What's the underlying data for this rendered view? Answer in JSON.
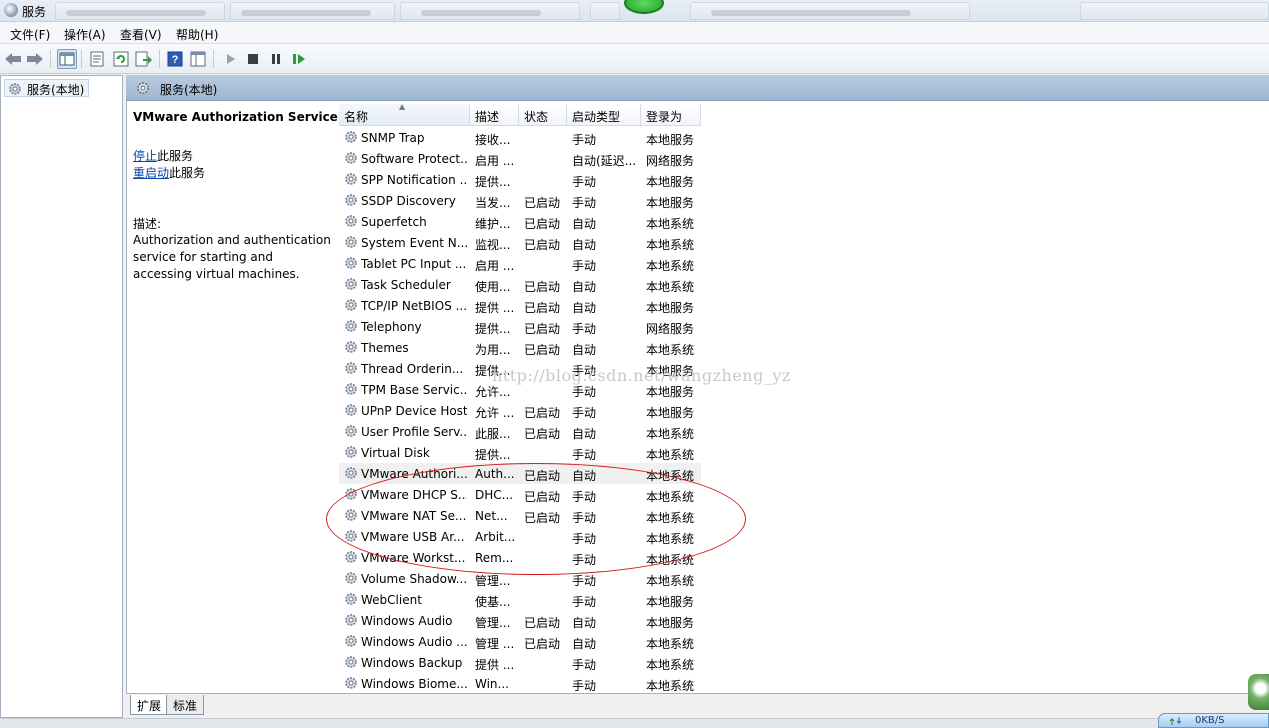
{
  "window": {
    "title": "服务"
  },
  "menubar": {
    "items": [
      "文件(F)",
      "操作(A)",
      "查看(V)",
      "帮助(H)"
    ]
  },
  "left_pane": {
    "tree_item": "服务(本地)"
  },
  "right_header": {
    "title": "服务(本地)"
  },
  "detail": {
    "service_title": "VMware Authorization Service",
    "stop_link": "停止",
    "stop_suffix": "此服务",
    "restart_link": "重启动",
    "restart_suffix": "此服务",
    "desc_label": "描述:",
    "desc_text": "Authorization and authentication service for starting and accessing virtual machines."
  },
  "table": {
    "columns": [
      "名称",
      "描述",
      "状态",
      "启动类型",
      "登录为"
    ],
    "rows": [
      {
        "name": "SNMP Trap",
        "desc": "接收...",
        "status": "",
        "start": "手动",
        "logon": "本地服务"
      },
      {
        "name": "Software Protect...",
        "desc": "启用 ...",
        "status": "",
        "start": "自动(延迟...",
        "logon": "网络服务"
      },
      {
        "name": "SPP Notification ...",
        "desc": "提供...",
        "status": "",
        "start": "手动",
        "logon": "本地服务"
      },
      {
        "name": "SSDP Discovery",
        "desc": "当发...",
        "status": "已启动",
        "start": "手动",
        "logon": "本地服务"
      },
      {
        "name": "Superfetch",
        "desc": "维护...",
        "status": "已启动",
        "start": "自动",
        "logon": "本地系统"
      },
      {
        "name": "System Event N...",
        "desc": "监视...",
        "status": "已启动",
        "start": "自动",
        "logon": "本地系统"
      },
      {
        "name": "Tablet PC Input ...",
        "desc": "启用 ...",
        "status": "",
        "start": "手动",
        "logon": "本地系统"
      },
      {
        "name": "Task Scheduler",
        "desc": "使用...",
        "status": "已启动",
        "start": "自动",
        "logon": "本地系统"
      },
      {
        "name": "TCP/IP NetBIOS ...",
        "desc": "提供 ...",
        "status": "已启动",
        "start": "自动",
        "logon": "本地服务"
      },
      {
        "name": "Telephony",
        "desc": "提供...",
        "status": "已启动",
        "start": "手动",
        "logon": "网络服务"
      },
      {
        "name": "Themes",
        "desc": "为用...",
        "status": "已启动",
        "start": "自动",
        "logon": "本地系统"
      },
      {
        "name": "Thread Orderin...",
        "desc": "提供...",
        "status": "",
        "start": "手动",
        "logon": "本地服务"
      },
      {
        "name": "TPM Base Servic...",
        "desc": "允许...",
        "status": "",
        "start": "手动",
        "logon": "本地服务"
      },
      {
        "name": "UPnP Device Host",
        "desc": "允许 ...",
        "status": "已启动",
        "start": "手动",
        "logon": "本地服务"
      },
      {
        "name": "User Profile Serv...",
        "desc": "此服...",
        "status": "已启动",
        "start": "自动",
        "logon": "本地系统"
      },
      {
        "name": "Virtual Disk",
        "desc": "提供...",
        "status": "",
        "start": "手动",
        "logon": "本地系统"
      },
      {
        "name": "VMware Authori...",
        "desc": "Auth...",
        "status": "已启动",
        "start": "自动",
        "logon": "本地系统"
      },
      {
        "name": "VMware DHCP S...",
        "desc": "DHC...",
        "status": "已启动",
        "start": "手动",
        "logon": "本地系统"
      },
      {
        "name": "VMware NAT Se...",
        "desc": "Net...",
        "status": "已启动",
        "start": "手动",
        "logon": "本地系统"
      },
      {
        "name": "VMware USB Ar...",
        "desc": "Arbit...",
        "status": "",
        "start": "手动",
        "logon": "本地系统"
      },
      {
        "name": "VMware Workst...",
        "desc": "Rem...",
        "status": "",
        "start": "手动",
        "logon": "本地系统"
      },
      {
        "name": "Volume Shadow...",
        "desc": "管理...",
        "status": "",
        "start": "手动",
        "logon": "本地系统"
      },
      {
        "name": "WebClient",
        "desc": "使基...",
        "status": "",
        "start": "手动",
        "logon": "本地服务"
      },
      {
        "name": "Windows Audio",
        "desc": "管理...",
        "status": "已启动",
        "start": "自动",
        "logon": "本地服务"
      },
      {
        "name": "Windows Audio ...",
        "desc": "管理 ...",
        "status": "已启动",
        "start": "自动",
        "logon": "本地系统"
      },
      {
        "name": "Windows Backup",
        "desc": "提供 ...",
        "status": "",
        "start": "手动",
        "logon": "本地系统"
      },
      {
        "name": "Windows Biome...",
        "desc": "Win...",
        "status": "",
        "start": "手动",
        "logon": "本地系统"
      }
    ],
    "selected_index": 16
  },
  "watermark": "http://blog.csdn.net/wangzheng_yz",
  "bottom_tabs": [
    "扩展",
    "标准"
  ],
  "taskbar": {
    "net_speed": "0KB/S"
  },
  "colors": {
    "highlight_ellipse": "#d21c1c",
    "link": "#0645ad",
    "header_bg": "#9eb6d1"
  }
}
